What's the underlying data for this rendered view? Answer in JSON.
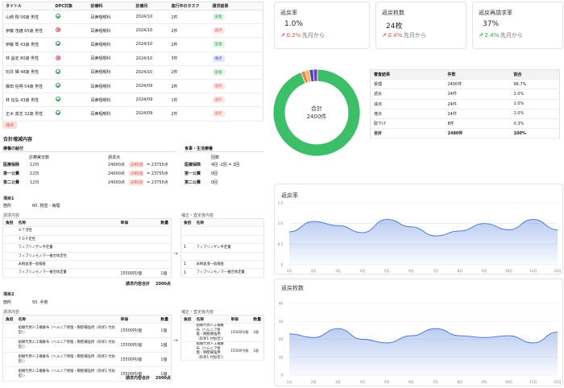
{
  "claims": {
    "headers": [
      "タイトル",
      "DPC対象",
      "診療科",
      "診療月",
      "進行中のタスク",
      "請求結果"
    ],
    "rows": [
      {
        "title": "山崎 翔 56歳 男性",
        "dpc": "ok",
        "dept": "耳鼻咽喉科",
        "month": "2024/10",
        "tasks": "2件",
        "result": "査復",
        "result_type": "green"
      },
      {
        "title": "伊藤 茂雄 65歳 男性",
        "dpc": "ng",
        "dept": "耳鼻咽喉科",
        "month": "2024/10",
        "tasks": "2件",
        "result": "減点",
        "result_type": "red"
      },
      {
        "title": "伊藤 隼 43歳 男性",
        "dpc": "ok",
        "dept": "耳鼻咽喉科",
        "month": "2024/10",
        "tasks": "2件",
        "result": "査復",
        "result_type": "green"
      },
      {
        "title": "林 昌史 80歳 男性",
        "dpc": "ng",
        "dept": "耳鼻咽喉科",
        "month": "2024/10",
        "tasks": "3件",
        "result": "増点",
        "result_type": "blue"
      },
      {
        "title": "石井 輝 48歳 男性",
        "dpc": "ok",
        "dept": "耳鼻咽喉科",
        "month": "2024/10",
        "tasks": "2件",
        "result": "査復",
        "result_type": "green"
      },
      {
        "title": "藤田 信明 54歳 男性",
        "dpc": "ok",
        "dept": "耳鼻咽喉科",
        "month": "2024/09",
        "tasks": "2件",
        "result": "返戻",
        "result_type": "red"
      },
      {
        "title": "林 信弘 43歳 男性",
        "dpc": "ok",
        "dept": "耳鼻咽喉科",
        "month": "2024/09",
        "tasks": "1件",
        "result": "返戻",
        "result_type": "red"
      },
      {
        "title": "正木 真志 32歳 男性",
        "dpc": "ok",
        "dept": "耳鼻咽喉科",
        "month": "2024/09",
        "tasks": "2件",
        "result": "返戻",
        "result_type": "red"
      }
    ]
  },
  "detail": {
    "status_tag": "減点",
    "section_title": "合計増減内容",
    "benefit_title": "療養の給付",
    "meal_title": "食事・生活療養",
    "col_days": "診療実日数",
    "col_points": "請求点",
    "col_times": "回数",
    "benefit_rows": [
      {
        "label": "医療保険",
        "days": "12日",
        "before": "24000点",
        "diff": "-245点",
        "after": "= 23755点"
      },
      {
        "label": "第一公費",
        "days": "12日",
        "before": "24000点",
        "diff": "-245点",
        "after": "= 23755点"
      },
      {
        "label": "第二公費",
        "days": "12日",
        "before": "24000点",
        "diff": "-245点",
        "after": "= 23755点"
      }
    ],
    "meal_rows": [
      {
        "label": "医療保険",
        "value": "4回 -2回 = 2回"
      },
      {
        "label": "第一公費",
        "value": "0回"
      },
      {
        "label": "第二公費",
        "value": "0回"
      }
    ],
    "item1": {
      "title": "項目1",
      "location_label": "箇所",
      "location": "60. 検査・病理",
      "request_label": "請求内容",
      "corrected_label": "補正・査定後内容",
      "col_burden": "負担",
      "col_name": "名称",
      "col_unit": "単価",
      "col_qty": "数量",
      "rows": [
        {
          "name": "ＡＴ活性",
          "unit": "",
          "qty": ""
        },
        {
          "name": "ＦＤＰ定性",
          "unit": "",
          "qty": ""
        },
        {
          "name": "フィブリノゲン半定量",
          "unit": "",
          "qty": ""
        },
        {
          "name": "フィブリンモノマー複合体定性",
          "unit": "",
          "qty": ""
        },
        {
          "name": "末梢血液一般検査",
          "unit": "",
          "qty": ""
        },
        {
          "name": "フィブリンモノマー複合体定量",
          "unit": "15500円/個",
          "qty": "1個"
        }
      ],
      "corrected_rows": [
        {
          "name": "フィブリノゲン半定量"
        },
        {
          "name": "末梢血液一般検査"
        },
        {
          "name": "フィブリンモノマー複合体定量"
        }
      ],
      "total_label": "請求内容合計",
      "total": "2000点"
    },
    "item2": {
      "title": "項目2",
      "location_label": "箇所",
      "location": "50. 手術",
      "request_label": "請求内容",
      "corrected_label": "補正・査定後内容",
      "col_burden": "負担",
      "col_name": "名称",
      "col_unit": "単価",
      "col_qty": "数量",
      "rows": [
        {
          "name": "組織代用人工繊維布（ヘルニア修復・胸壁補強用（形状1 付加型））",
          "unit": "15500円/個",
          "qty": "1個"
        },
        {
          "name": "組織代用人工繊維布（ヘルニア修復・胸壁補強用（形状1 付加型））",
          "unit": "15500円/個",
          "qty": "1個"
        },
        {
          "name": "組織代用人工繊維布（ヘルニア修復・胸壁補強用（形状1 付加型））",
          "unit": "15500円/個",
          "qty": "1個"
        },
        {
          "name": "組織代用人工繊維布（ヘルニア修復・胸壁補強用（形状1 付加型））",
          "unit": "15500円/個",
          "qty": "1個"
        }
      ],
      "corrected_rows": [
        {
          "name": "組織代用人工繊維布（ヘルニア修復・胸壁補強用（形状1 付加型））",
          "unit": "15500円/個",
          "qty": "1個"
        },
        {
          "name": "組織代用人工繊維布（ヘルニア修復・胸壁補強用（形状1 付加型））",
          "unit": "15500円/個",
          "qty": "1個"
        }
      ],
      "total_label": "請求内容合計",
      "total": "2000点"
    }
  },
  "kpis": [
    {
      "label": "返戻率",
      "value": "1.0%",
      "delta": "0.2%",
      "delta_dir": "up-bad",
      "sub": "先月から"
    },
    {
      "label": "返戻枚数",
      "value": "24枚",
      "delta": "0.4%",
      "delta_dir": "up-bad",
      "sub": "先月から"
    },
    {
      "label": "返戻再請求率",
      "value": "37%",
      "delta": "2.4%",
      "delta_dir": "up-good",
      "sub": "先月から"
    }
  ],
  "donut": {
    "center_label": "合計",
    "center_value": "2400件",
    "slices": [
      {
        "name": "受理",
        "value": 96.7,
        "color": "#3dbf6a"
      },
      {
        "name": "返戻",
        "value": 1.0,
        "color": "#f07f4a"
      },
      {
        "name": "減点",
        "value": 1.0,
        "color": "#ffb44d"
      },
      {
        "name": "増点",
        "value": 1.0,
        "color": "#3c4fc7"
      },
      {
        "name": "取下げ",
        "value": 0.3,
        "color": "#7b3fb5"
      }
    ]
  },
  "summary": {
    "headers": [
      "審査結果",
      "件数",
      "割合"
    ],
    "rows": [
      [
        "受理",
        "2400件",
        "96.7%"
      ],
      [
        "返戻",
        "24件",
        "1.0%"
      ],
      [
        "減点",
        "24件",
        "1.0%"
      ],
      [
        "増点",
        "24件",
        "1.0%"
      ],
      [
        "取下げ",
        "8件",
        "0.3%"
      ]
    ],
    "total": [
      "合計",
      "2480件",
      "100%"
    ]
  },
  "chart_data": [
    {
      "type": "area",
      "title": "返戻率",
      "categories": [
        "1月",
        "2月",
        "3月",
        "4月",
        "5月",
        "6月",
        "7月",
        "8月",
        "9月",
        "10月",
        "11月",
        "12月"
      ],
      "values": [
        0.8,
        1.05,
        0.95,
        0.78,
        1.1,
        0.92,
        0.7,
        0.82,
        1.0,
        0.85,
        1.1,
        0.85
      ],
      "yticks": [
        "0",
        "0.5",
        "1.0",
        "1.5"
      ],
      "ylim": [
        0,
        1.5
      ],
      "color": "#3c6fd8"
    },
    {
      "type": "area",
      "title": "返戻枚数",
      "categories": [
        "1月",
        "2月",
        "3月",
        "4月",
        "5月",
        "6月",
        "7月",
        "8月",
        "9月",
        "10月",
        "11月",
        "12月"
      ],
      "values": [
        23,
        21,
        26,
        20,
        18,
        22,
        26,
        22,
        21,
        22,
        18,
        24
      ],
      "yticks": [
        "0",
        "10",
        "20",
        "30",
        "40"
      ],
      "ylim": [
        0,
        40
      ],
      "color": "#3c6fd8"
    }
  ]
}
